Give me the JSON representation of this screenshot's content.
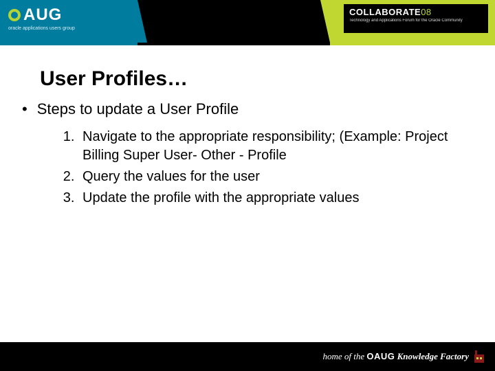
{
  "header": {
    "logo_text": "AUG",
    "tagline": "oracle applications users group",
    "collab_title": "COLLABORATE",
    "collab_year": "08",
    "collab_sub": "Technology and Applications Forum for the Oracle Community"
  },
  "body": {
    "title": "User Profiles…",
    "bullet": "Steps to update a User Profile",
    "steps": [
      "Navigate to the appropriate responsibility; (Example: Project Billing Super User-  Other - Profile",
      "Query the values for the user",
      "Update the profile with the appropriate values"
    ]
  },
  "footer": {
    "prefix": "home of the ",
    "brand": "OAUG",
    "suffix1": " Knowledge ",
    "suffix2": "Factory"
  }
}
